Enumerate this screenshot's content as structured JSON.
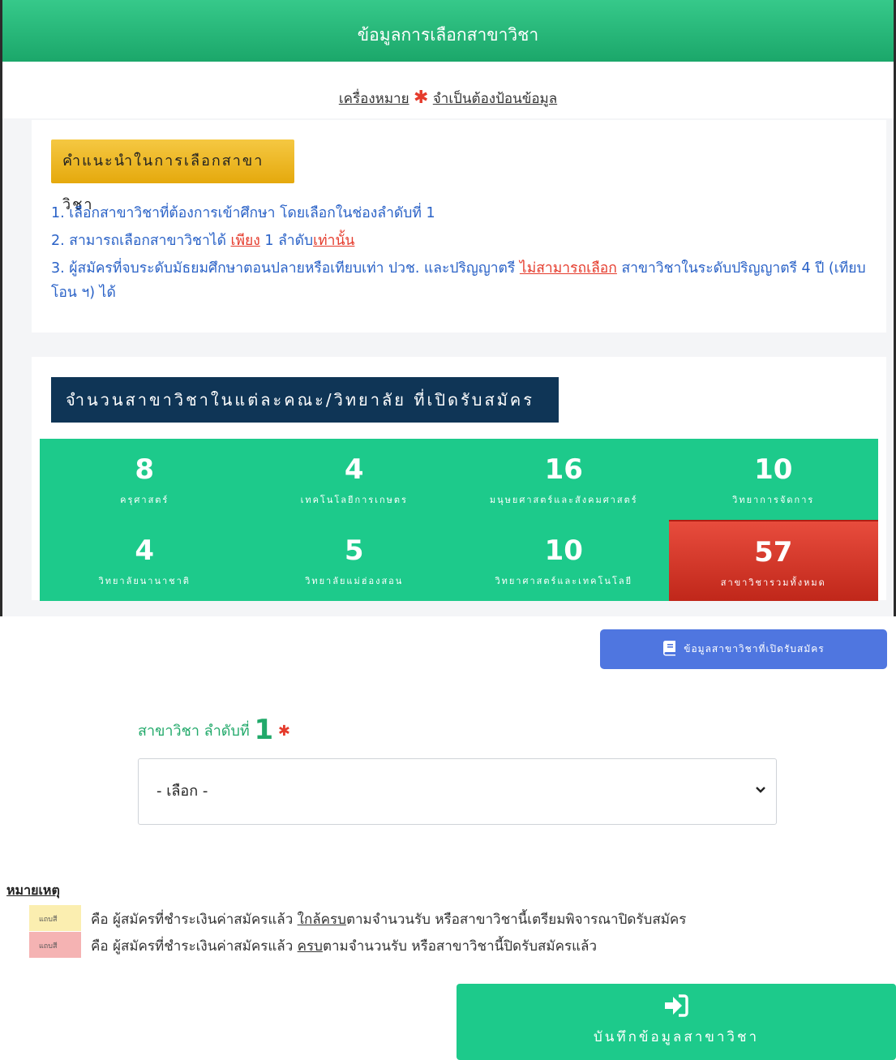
{
  "header": {
    "title": "ข้อมูลการเลือกสาขาวิชา"
  },
  "legend_note": {
    "prefix": "เครื่องหมาย",
    "star": "✱",
    "suffix": "จำเป็นต้องป้อนข้อมูล"
  },
  "instructions": {
    "title": "คำแนะนำในการเลือกสาขาวิชา",
    "line1": "1. เลือกสาขาวิชาที่ต้องการเข้าศึกษา โดยเลือกในช่องลำดับที่ 1",
    "line2": {
      "a": "2. สามารถเลือกสาขาวิชาได้ ",
      "b": "เพียง",
      "c": " 1 ลำดับ",
      "d": "เท่านั้น"
    },
    "line3": {
      "a": "3. ผู้สมัครที่จบระดับมัธยมศึกษาตอนปลายหรือเทียบเท่า  ปวช. และปริญญาตรี ",
      "b": "ไม่สามารถเลือก",
      "c": " สาขาวิชาในระดับปริญญาตรี 4 ปี (เทียบโอน ฯ) ได้"
    }
  },
  "counts": {
    "title": "จำนวนสาขาวิชาในแต่ละคณะ/วิทยาลัย ที่เปิดรับสมัคร",
    "tiles": [
      {
        "value": "8",
        "label": "ครุศาสตร์"
      },
      {
        "value": "4",
        "label": "เทคโนโลยีการเกษตร"
      },
      {
        "value": "16",
        "label": "มนุษยศาสตร์และสังคมศาสตร์"
      },
      {
        "value": "10",
        "label": "วิทยาการจัดการ"
      },
      {
        "value": "4",
        "label": "วิทยาลัยนานาชาติ"
      },
      {
        "value": "5",
        "label": "วิทยาลัยแม่ฮ่องสอน"
      },
      {
        "value": "10",
        "label": "วิทยาศาสตร์และเทคโนโลยี"
      },
      {
        "value": "57",
        "label": "สาขาวิชารวมทั้งหมด"
      }
    ]
  },
  "branch_info_button": {
    "label": "ข้อมูลสาขาวิชาที่เปิดรับสมัคร",
    "icon": "book-icon"
  },
  "selection": {
    "label": "สาขาวิชา ลำดับที่",
    "number": "1",
    "star": "✱",
    "value": "- เลือก -"
  },
  "remarks": {
    "title": "หมายเหตุ",
    "items": [
      {
        "swatch_text": "แถบสี",
        "color": "#fbeeb0",
        "a": "คือ  ผู้สมัครที่ชำระเงินค่าสมัครแล้ว ",
        "b": "ใกล้ครบ",
        "c": "ตามจำนวนรับ หรือสาขาวิชานี้เตรียมพิจารณาปิดรับสมัคร"
      },
      {
        "swatch_text": "แถบสี",
        "color": "#f5b3b3",
        "a": "คือ  ผู้สมัครที่ชำระเงินค่าสมัครแล้ว ",
        "b": "ครบ",
        "c": "ตามจำนวนรับ หรือสาขาวิชานี้ปิดรับสมัครแล้ว"
      }
    ]
  },
  "save_button": {
    "label": "บันทึกข้อมูลสาขาวิชา",
    "icon": "sign-in-icon"
  },
  "colors": {
    "green": "#1dca8b",
    "navy": "#0f3556",
    "red": "#e84c3d",
    "gold": "#f5c842",
    "blue": "#4f76e0"
  }
}
